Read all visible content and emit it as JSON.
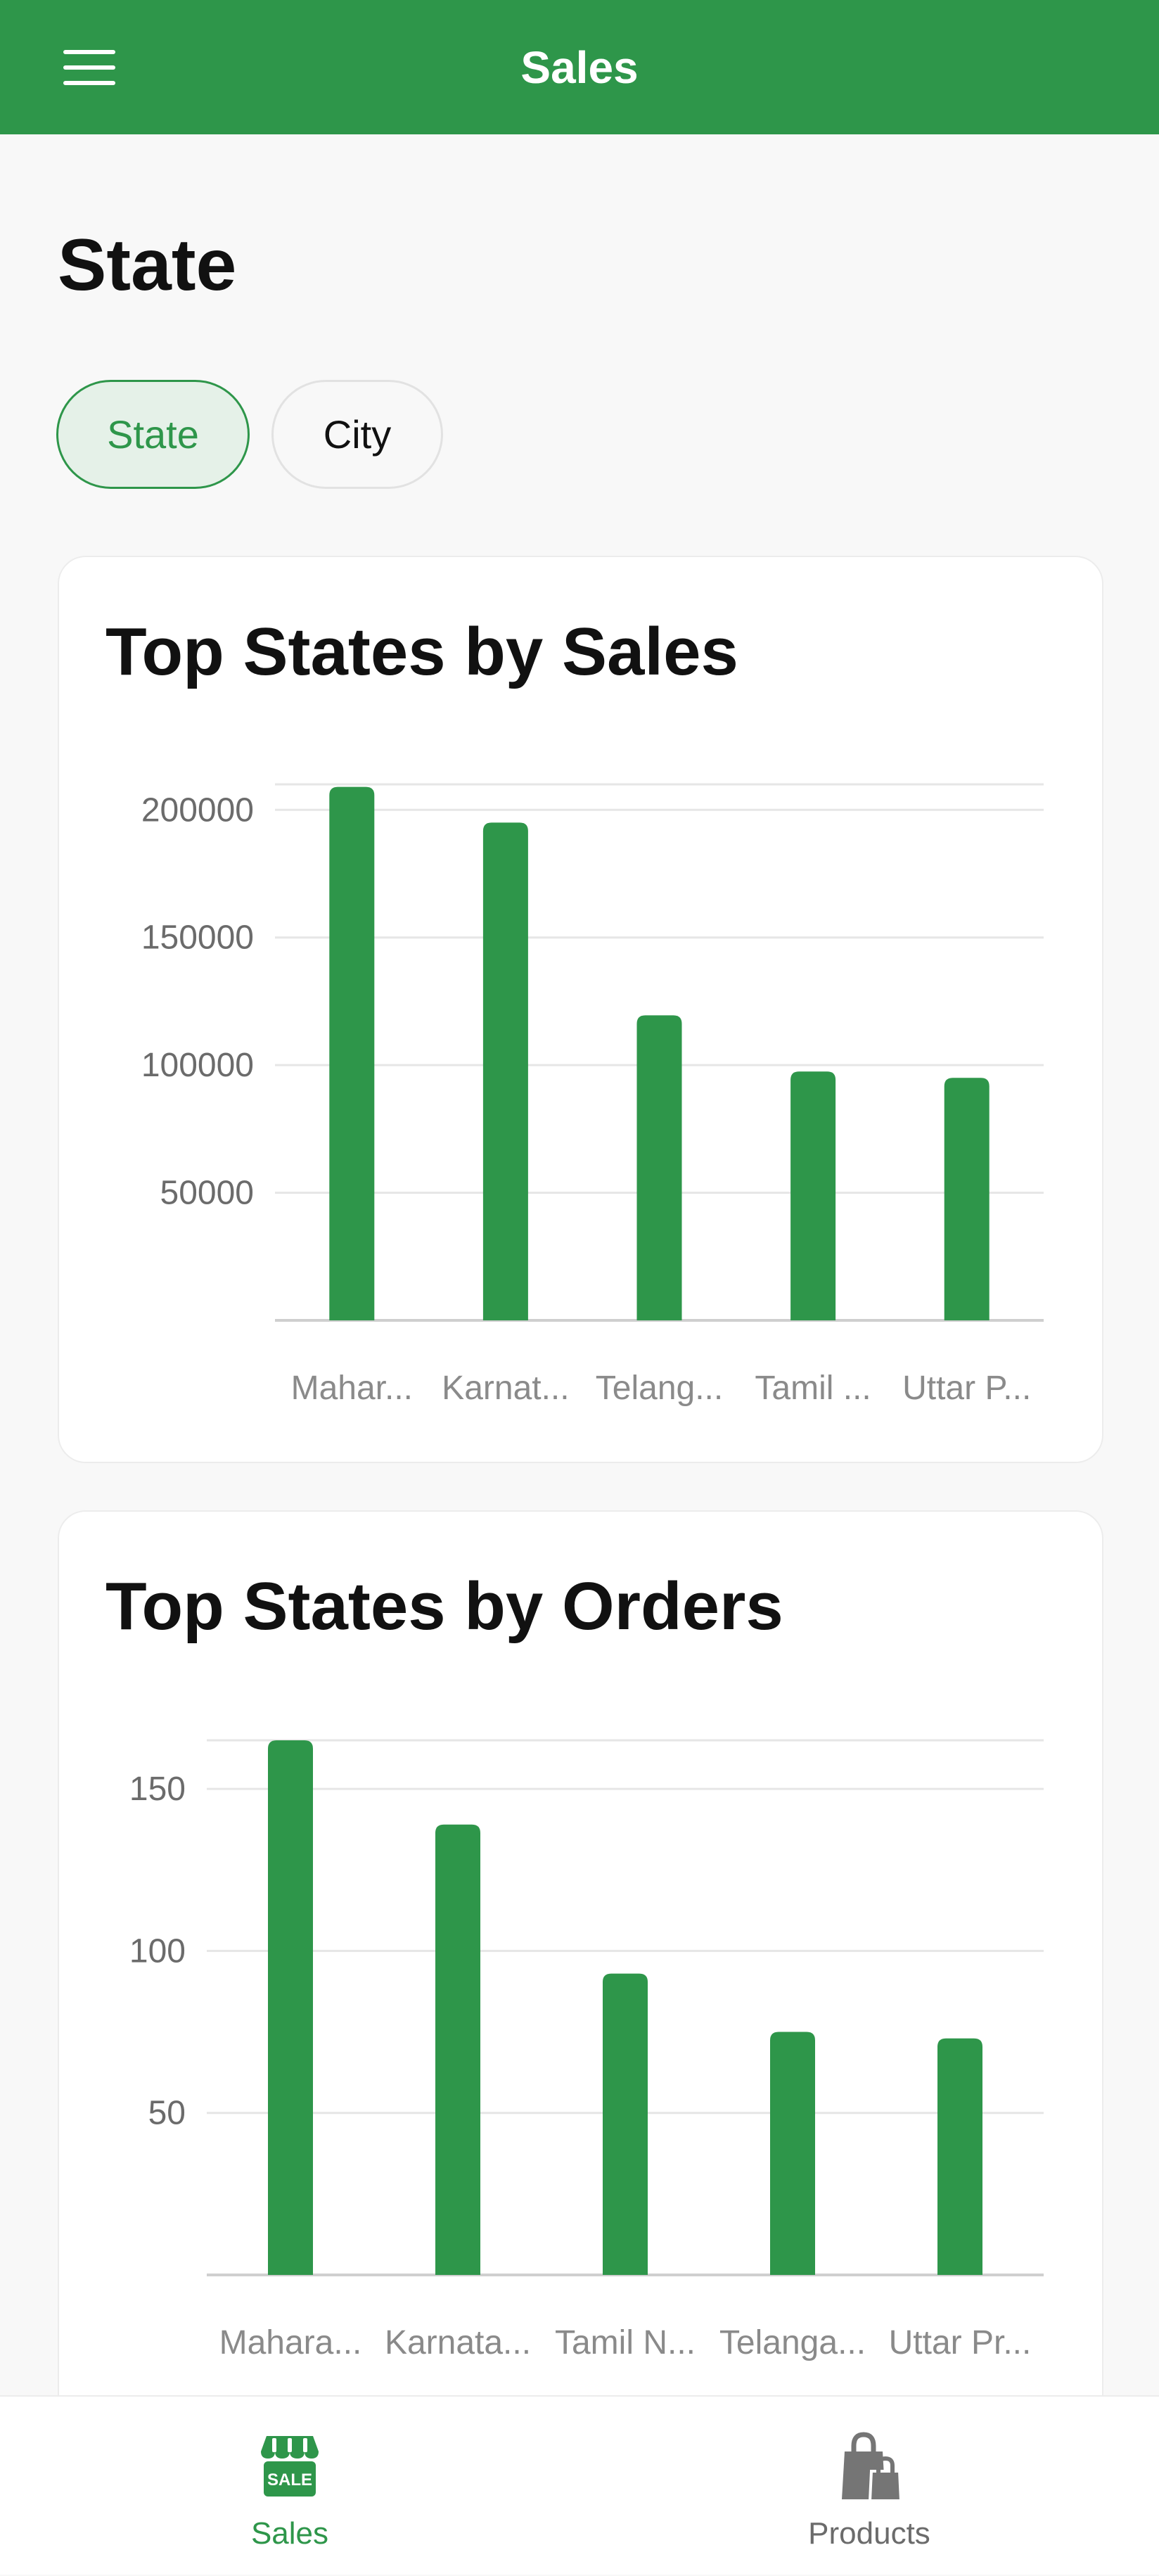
{
  "appbar": {
    "title": "Sales",
    "menu_icon": "hamburger-menu-icon"
  },
  "page": {
    "heading": "State"
  },
  "filters": {
    "chips": [
      {
        "label": "State",
        "selected": true
      },
      {
        "label": "City",
        "selected": false
      }
    ]
  },
  "colors": {
    "primary": "#2e964a",
    "chip_selected_bg": "#e5f1e8",
    "muted": "#6b6b6b"
  },
  "chart_data": [
    {
      "type": "bar",
      "title": "Top States by Sales",
      "categories": [
        "Mahar...",
        "Karnat...",
        "Telang...",
        "Tamil ...",
        "Uttar P..."
      ],
      "values": [
        209000,
        195000,
        119500,
        97500,
        95000
      ],
      "yticks": [
        50000,
        100000,
        150000,
        200000
      ],
      "ylim": [
        0,
        210000
      ],
      "xlabel": "",
      "ylabel": "",
      "grid": true
    },
    {
      "type": "bar",
      "title": "Top States by Orders",
      "categories": [
        "Mahara...",
        "Karnata...",
        "Tamil N...",
        "Telanga...",
        "Uttar Pr..."
      ],
      "values": [
        165,
        139,
        93,
        75,
        73
      ],
      "yticks": [
        50,
        100,
        150
      ],
      "ylim": [
        0,
        165
      ],
      "xlabel": "",
      "ylabel": "",
      "grid": true
    }
  ],
  "bottom_nav": {
    "items": [
      {
        "label": "Sales",
        "icon": "sale-store-icon",
        "active": true
      },
      {
        "label": "Products",
        "icon": "shopping-bag-icon",
        "active": false
      }
    ]
  }
}
